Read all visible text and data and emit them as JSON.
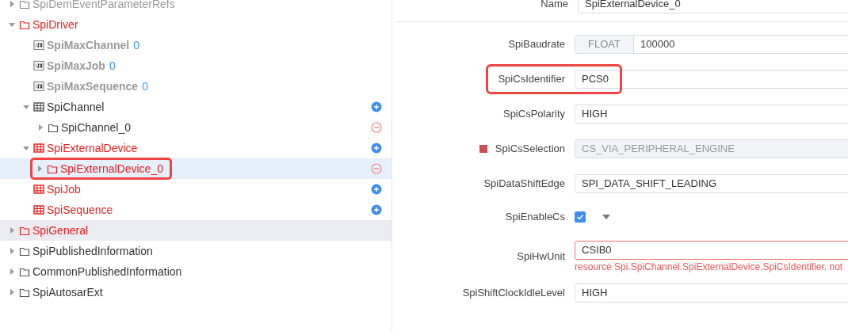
{
  "tree": [
    {
      "label": "SpiDemEventParameterRefs",
      "kind": "folder",
      "inactive": true,
      "error": false,
      "expandable": true,
      "expanded": false,
      "selected": false,
      "hovered": false,
      "highlighted": false,
      "addable": false,
      "removable": false
    },
    {
      "label": "SpiDriver",
      "kind": "folder",
      "inactive": false,
      "error": true,
      "expandable": true,
      "expanded": true,
      "selected": false,
      "hovered": false,
      "highlighted": false,
      "addable": false,
      "removable": false,
      "children": [
        {
          "label": "SpiMaxChannel",
          "kind": "parameter",
          "inactive": true,
          "error": false,
          "value": "0",
          "expandable": false,
          "expanded": false,
          "selected": false,
          "hovered": false,
          "highlighted": false,
          "addable": false,
          "removable": false
        },
        {
          "label": "SpiMaxJob",
          "kind": "parameter",
          "inactive": true,
          "error": false,
          "value": "0",
          "expandable": false,
          "expanded": false,
          "selected": false,
          "hovered": false,
          "highlighted": false,
          "addable": false,
          "removable": false
        },
        {
          "label": "SpiMaxSequence",
          "kind": "parameter",
          "inactive": true,
          "error": false,
          "value": "0",
          "expandable": false,
          "expanded": false,
          "selected": false,
          "hovered": false,
          "highlighted": false,
          "addable": false,
          "removable": false
        },
        {
          "label": "SpiChannel",
          "kind": "table",
          "inactive": false,
          "error": false,
          "expandable": true,
          "expanded": true,
          "selected": false,
          "hovered": false,
          "highlighted": false,
          "addable": true,
          "removable": false,
          "children": [
            {
              "label": "SpiChannel_0",
              "kind": "folder",
              "inactive": false,
              "error": false,
              "expandable": true,
              "expanded": false,
              "selected": false,
              "hovered": false,
              "highlighted": false,
              "addable": false,
              "removable": true
            }
          ]
        },
        {
          "label": "SpiExternalDevice",
          "kind": "table",
          "inactive": false,
          "error": true,
          "expandable": true,
          "expanded": true,
          "selected": false,
          "hovered": false,
          "highlighted": false,
          "addable": true,
          "removable": false,
          "children": [
            {
              "label": "SpiExternalDevice_0",
              "kind": "folder",
              "inactive": false,
              "error": true,
              "expandable": true,
              "expanded": false,
              "selected": true,
              "hovered": false,
              "highlighted": true,
              "addable": false,
              "removable": true
            }
          ]
        },
        {
          "label": "SpiJob",
          "kind": "table",
          "inactive": false,
          "error": true,
          "expandable": false,
          "expanded": false,
          "selected": false,
          "hovered": false,
          "highlighted": false,
          "addable": true,
          "removable": false
        },
        {
          "label": "SpiSequence",
          "kind": "table",
          "inactive": false,
          "error": true,
          "expandable": false,
          "expanded": false,
          "selected": false,
          "hovered": false,
          "highlighted": false,
          "addable": true,
          "removable": false
        }
      ]
    },
    {
      "label": "SpiGeneral",
      "kind": "folder",
      "inactive": false,
      "error": true,
      "expandable": true,
      "expanded": false,
      "selected": false,
      "hovered": true,
      "highlighted": false,
      "addable": false,
      "removable": false
    },
    {
      "label": "SpiPublishedInformation",
      "kind": "folder",
      "inactive": false,
      "error": false,
      "expandable": true,
      "expanded": false,
      "selected": false,
      "hovered": false,
      "highlighted": false,
      "addable": false,
      "removable": false
    },
    {
      "label": "CommonPublishedInformation",
      "kind": "folder",
      "inactive": false,
      "error": false,
      "expandable": true,
      "expanded": false,
      "selected": false,
      "hovered": false,
      "highlighted": false,
      "addable": false,
      "removable": false
    },
    {
      "label": "SpiAutosarExt",
      "kind": "folder",
      "inactive": false,
      "error": false,
      "expandable": true,
      "expanded": false,
      "selected": false,
      "hovered": false,
      "highlighted": false,
      "addable": false,
      "removable": false
    }
  ],
  "name_field": {
    "label": "Name",
    "value": "SpiExternalDevice_0"
  },
  "fields": [
    {
      "label": "SpiBaudrate",
      "kind": "typed",
      "type_tag": "FLOAT",
      "value": "100000",
      "disabled": false,
      "highlighted": false,
      "marker": false
    },
    {
      "label": "SpiCsIdentifier",
      "kind": "text",
      "value": "PCS0",
      "disabled": false,
      "highlighted": true,
      "marker": false
    },
    {
      "label": "SpiCsPolarity",
      "kind": "text",
      "value": "HIGH",
      "disabled": false,
      "highlighted": false,
      "marker": false
    },
    {
      "label": "SpiCsSelection",
      "kind": "text",
      "value": "CS_VIA_PERIPHERAL_ENGINE",
      "disabled": true,
      "highlighted": false,
      "marker": true
    },
    {
      "label": "SpiDataShiftEdge",
      "kind": "text",
      "value": "SPI_DATA_SHIFT_LEADING",
      "disabled": false,
      "highlighted": false,
      "marker": false
    },
    {
      "label": "SpiEnableCs",
      "kind": "checkbox",
      "checked": true,
      "disabled": false,
      "highlighted": false,
      "marker": false
    },
    {
      "label": "SpiHwUnit",
      "kind": "text",
      "value": "CSIB0",
      "error": "resource Spi.SpiChannel.SpiExternalDevice.SpiCsIdentifier. not",
      "disabled": false,
      "highlighted": false,
      "marker": false
    },
    {
      "label": "SpiShiftClockIdleLevel",
      "kind": "text",
      "value": "HIGH",
      "disabled": false,
      "highlighted": false,
      "marker": false
    }
  ]
}
